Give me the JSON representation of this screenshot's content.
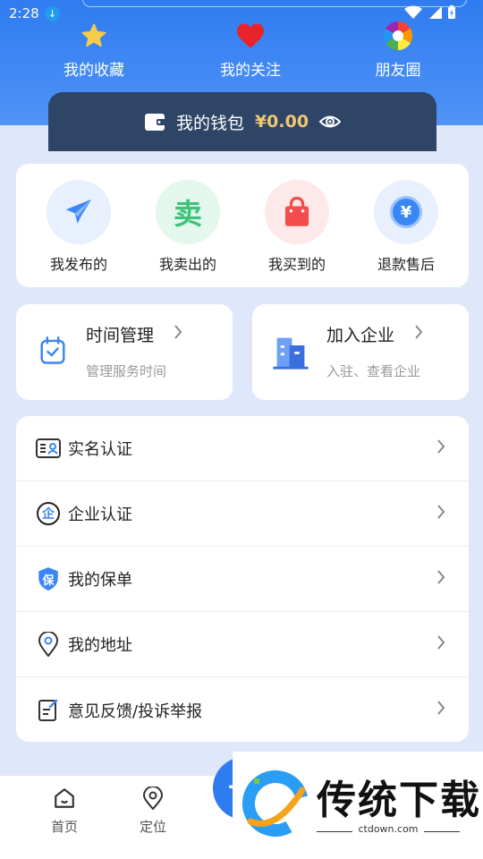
{
  "status": {
    "time": "2:28"
  },
  "top": {
    "favorites": "我的收藏",
    "follows": "我的关注",
    "moments": "朋友圈"
  },
  "wallet": {
    "label": "我的钱包",
    "amount": "¥0.00"
  },
  "quick": [
    {
      "label": "我发布的",
      "icon": "paper-plane-icon"
    },
    {
      "label": "我卖出的",
      "icon": "sell-icon",
      "glyph": "卖"
    },
    {
      "label": "我买到的",
      "icon": "shopping-bag-icon"
    },
    {
      "label": "退款售后",
      "icon": "refund-icon",
      "glyph": "¥"
    }
  ],
  "features": {
    "time": {
      "title": "时间管理",
      "sub": "管理服务时间"
    },
    "company": {
      "title": "加入企业",
      "sub": "入驻、查看企业"
    }
  },
  "menu": [
    {
      "label": "实名认证",
      "icon": "id-card-icon"
    },
    {
      "label": "企业认证",
      "icon": "enterprise-icon",
      "glyph": "企"
    },
    {
      "label": "我的保单",
      "icon": "shield-icon",
      "glyph": "保"
    },
    {
      "label": "我的地址",
      "icon": "location-pin-icon"
    },
    {
      "label": "意见反馈/投诉举报",
      "icon": "feedback-icon"
    }
  ],
  "tabs": {
    "home": "首页",
    "locate": "定位"
  },
  "watermark": {
    "title": "传统下载",
    "url": "ctdown.com"
  },
  "colors": {
    "primary": "#2f7cf0",
    "wallet_bg": "#2e4566",
    "gold": "#f1c675"
  }
}
